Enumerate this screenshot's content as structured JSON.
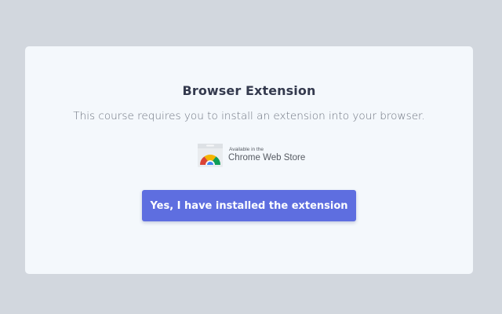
{
  "dialog": {
    "title": "Browser Extension",
    "message": "This course requires you to install an extension into your browser."
  },
  "store_badge": {
    "small_text": "Available in the",
    "large_text": "Chrome Web Store",
    "icon": "chrome-web-store-icon"
  },
  "confirm_button": {
    "label": "Yes, I have installed the extension",
    "color": "#5e6ee0"
  },
  "colors": {
    "background": "#d2d7de",
    "card": "#f4f8fc",
    "title": "#343a4e",
    "text": "#6e7480"
  }
}
